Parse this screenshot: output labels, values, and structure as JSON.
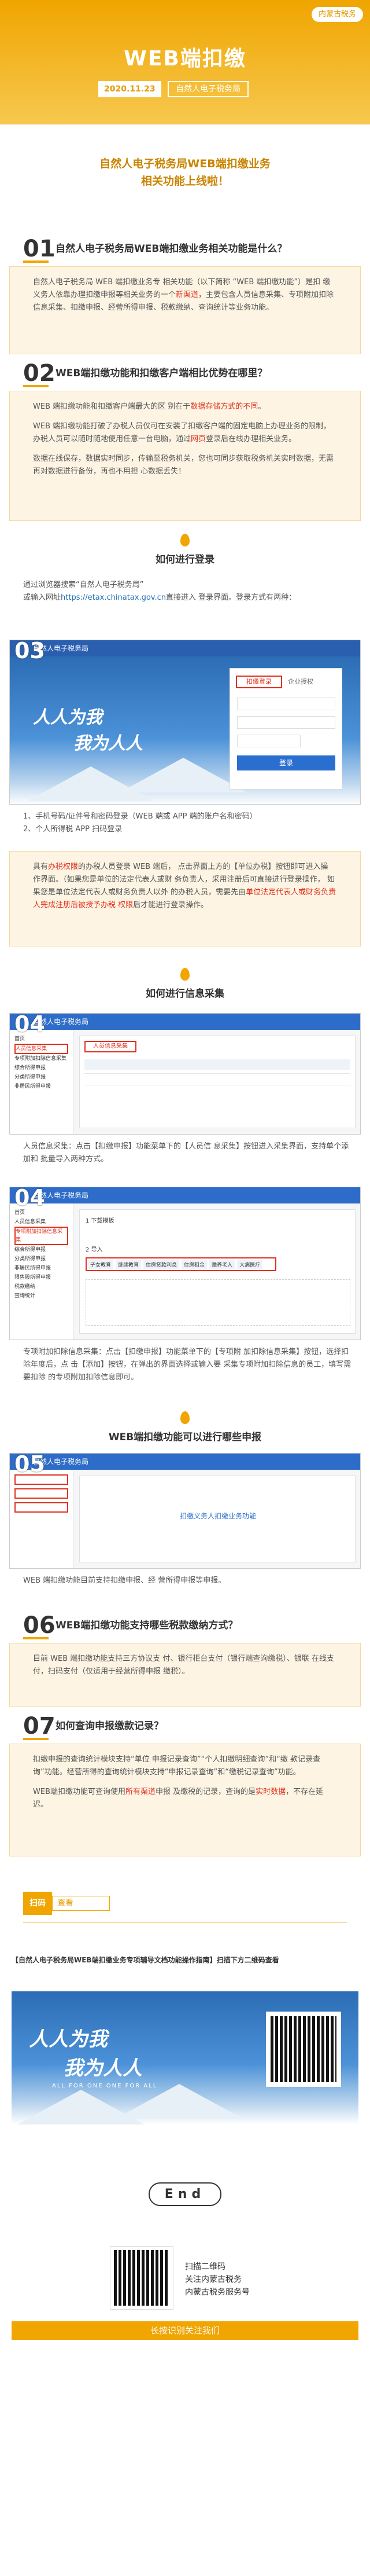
{
  "header": {
    "badge": "内蒙古税务",
    "title": "WEB端扣缴",
    "date": "2020.11.23",
    "bureau": "自然人电子税务局"
  },
  "lead": {
    "line1": "自然人电子税务局WEB端扣缴业务",
    "line2": "相关功能上线啦！"
  },
  "q1": {
    "number": "01",
    "title": "自然人电子税务局WEB端扣缴业务相关功能是什么？",
    "text": "自然人电子税务局 WEB 端扣缴业务专 相关功能（以下简称 “WEB 端扣缴功能”）是扣 缴义务人依靠办理扣缴申报等相关业务的一个",
    "highlight": "新渠道",
    "text2": "，主要包含人员信息采集、专项附加扣除信息采集、扣缴申报、经营所得申报、税款缴纳、查询统计等业务功能。"
  },
  "q2": {
    "number": "02",
    "title": "WEB端扣缴功能和扣缴客户端相比优势在哪里？",
    "p1a": "WEB 端扣缴功能和扣缴客户端最大的区 别在于",
    "p1b": "数据存储方式的不同",
    "p1c": "。",
    "p2a": "WEB 端扣缴功能打破了办税人员仅可在安装了扣缴客户端的固定电脑上办理业务的限制， 办税人员可以随时随地使用任意一台电脑，通过",
    "p2b": "网页",
    "p2c": "登录后在线办理相关业务。",
    "p3a": "数据在线保存，",
    "p3b": "数据实时同步，传输至税务机关，您也可同步获取税务机关实时数据，无需再对数据进行备份，再也不用担 心数据丢失！"
  },
  "login": {
    "section_title": "如何进行登录",
    "text1": "通过浏览器搜索“自然人电子税务局”",
    "text2a": "或输入网址",
    "text2b": "https://etax.chinatax.gov.cn",
    "text2c": "直接进入 登录界面。登录方式有两种：",
    "screenshot_number": "03",
    "portal_name": "自然人电子税务局",
    "slogan1": "人人为我",
    "slogan2": "我为人人",
    "tab_login": "扣缴登录",
    "tab_cert": "企业授权",
    "login_button": "登录",
    "method1": "1、手机号码/证件号和密码登录（WEB 端或 APP 端的账户名和密码）",
    "method2": "2、个人所得税 APP 扫码登录",
    "note_a": "具有",
    "note_b": "办税权限",
    "note_c": "的办税人员登录 WEB 端后， 点击界面上方的【单位办税】按钮即可进入操 作界面。（如果您是单位的法定代表人或财 务负责人，采用注册后可直接进行登录操作，  如果您是单位法定代表人或财务负责人以外  的办税人员，需要先由",
    "note_d": "单位法定代表人或财务负责人完成注册后被授予办税 权限",
    "note_e": "后才能进行登录操作。"
  },
  "collect": {
    "section_title": "如何进行信息采集",
    "screenshot_number": "04",
    "portal_name": "自然人电子税务局",
    "side_items": [
      "首页",
      "人员信息采集",
      "专项附加扣除信息采集",
      "综合所得申报",
      "分类所得申报",
      "非居民所得申报",
      "限售股所得申报",
      "税款缴纳",
      "查询统计"
    ],
    "tab_label": "人员信息采集",
    "text1a": "人员信息采集：点击【扣缴申报】功能菜单下的【人员信 息采集】按钮进入采集界面，支持单个添加和 批量导入两种方式。",
    "screenshot2_number": "04",
    "step_tabs": [
      "子女教育",
      "继续教育",
      "住房贷款利息",
      "住房租金",
      "赡养老人",
      "大病医疗"
    ],
    "download_label": "1 下载模板",
    "import_label": "2 导入",
    "text2": "专项附加扣除信息采集：点击【扣缴申报】功能菜单下的【专项附 加扣除信息采集】按钮，选择扣除年度后，点 击【添加】按钮，在弹出的界面选择或输入要 采集专项附加扣除信息的员工，填写需要扣除 的专项附加扣除信息即可。"
  },
  "declare": {
    "section_title": "WEB端扣缴功能可以进行哪些申报",
    "screenshot_number": "05",
    "portal_name": "自然人电子税务局",
    "notice": "扣缴义务人扣缴业务功能",
    "text": "WEB 端扣缴功能目前支持扣缴申报、经 营所得申报等申报。"
  },
  "q6": {
    "number": "06",
    "title": "WEB端扣缴功能支持哪些税款缴纳方式？",
    "text": "目前 WEB 端扣缴功能支持三方协议支 付、银行柜台支付（银行端查询缴税）、银联 在线支付，扫码支付（仅适用于经营所得申报 缴税）。"
  },
  "q7": {
    "number": "07",
    "title": "如何查询申报缴款记录？",
    "text1": "扣缴申报的查询统计模块支持“单位 申报记录查询”“个人扣缴明细查询”和“缴 款记录查询”功能。经营所得的查询统计模块支持“申报记录查询”和“缴税记录查询”功能。",
    "text2a": "WEB端扣缴功能可查询使用",
    "text2b": "所有渠道",
    "text2c": "申报 及缴税的记录，查询的是",
    "text2d": "实时数据",
    "text2e": "，不存在延迟。"
  },
  "scan": {
    "tag_a": "扫码",
    "tag_b": "查看",
    "caption_a": "【自然人电子税务局WEB端扣缴业务专项辅导文档",
    "caption_b": "功能操作指南】扫描下方二维码查看",
    "slogan1": "人人为我",
    "slogan2": "我为人人",
    "slogan_en": "ALL FOR ONE  ONE FOR ALL"
  },
  "footer": {
    "end": "End",
    "qr_text1": "扫描二维码",
    "qr_text2": "关注内蒙古税务",
    "qr_text3": "内蒙古税务服务号",
    "bottom_bar": "长按识别关注我们"
  }
}
